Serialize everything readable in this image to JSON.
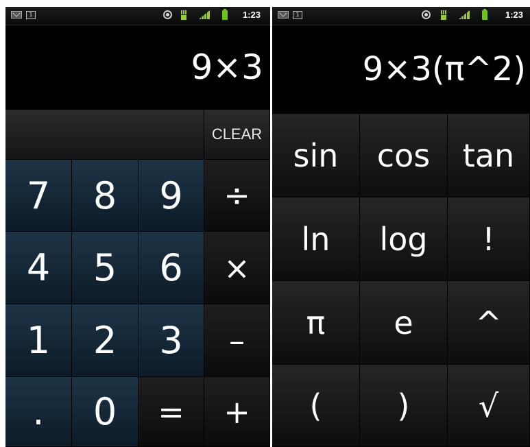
{
  "left": {
    "status": {
      "time": "1:23",
      "calendar_day": "1"
    },
    "display": "9×3",
    "clear_label": "CLEAR",
    "digits": [
      "7",
      "8",
      "9",
      "4",
      "5",
      "6",
      "1",
      "2",
      "3",
      ".",
      "0"
    ],
    "ops": {
      "divide": "÷",
      "multiply": "×",
      "minus": "–",
      "equals": "=",
      "plus": "+"
    }
  },
  "right": {
    "status": {
      "time": "1:23",
      "calendar_day": "1"
    },
    "display": "9×3(π^2)",
    "functions": [
      "sin",
      "cos",
      "tan",
      "ln",
      "log",
      "!",
      "π",
      "e",
      "^",
      "(",
      ")",
      "√"
    ]
  },
  "colors": {
    "digit_key": "#14293a",
    "operator_key": "#141414",
    "status_green": "#9ccc31"
  },
  "icons": [
    "gmail-icon",
    "calendar-icon",
    "gps-icon",
    "data-icon",
    "signal-icon",
    "battery-icon"
  ]
}
